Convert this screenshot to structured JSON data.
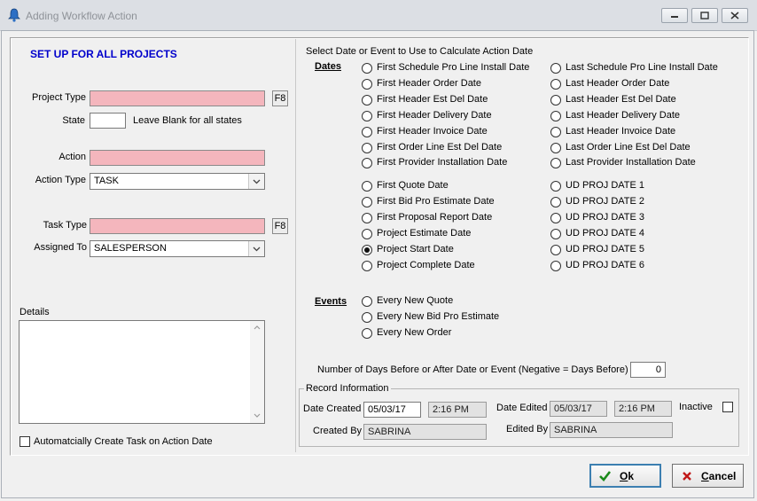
{
  "window": {
    "title": "Adding Workflow Action",
    "icon": "bell-icon"
  },
  "left": {
    "heading": "SET UP FOR ALL PROJECTS",
    "project_type_label": "Project Type",
    "f8_label": "F8",
    "state_label": "State",
    "state_value": "",
    "state_hint": "Leave Blank for all states",
    "action_label": "Action",
    "action_type_label": "Action Type",
    "action_type_value": "TASK",
    "task_type_label": "Task Type",
    "assigned_to_label": "Assigned To",
    "assigned_to_value": "SALESPERSON",
    "details_label": "Details",
    "auto_create_label": "Automatcially Create Task on Action Date"
  },
  "right": {
    "heading": "Select Date or Event to Use to Calculate Action Date",
    "dates_label": "Dates",
    "dates_col1": [
      "First Schedule Pro Line Install Date",
      "First Header Order Date",
      "First Header Est Del Date",
      "First Header Delivery Date",
      "First Header Invoice Date",
      "First Order Line Est Del Date",
      "First Provider Installation Date"
    ],
    "dates_col2": [
      "Last Schedule Pro Line Install Date",
      "Last Header Order Date",
      "Last Header Est Del Date",
      "Last Header Delivery Date",
      "Last Header Invoice Date",
      "Last Order Line Est Del Date",
      "Last Provider Installation Date"
    ],
    "project_col1": [
      "First Quote Date",
      "First Bid Pro Estimate Date",
      "First Proposal Report Date",
      "Project Estimate Date",
      "Project Start Date",
      "Project Complete Date"
    ],
    "project_col2": [
      "UD PROJ DATE 1",
      "UD PROJ DATE 2",
      "UD PROJ DATE 3",
      "UD PROJ DATE 4",
      "UD PROJ DATE 5",
      "UD PROJ DATE 6"
    ],
    "selected": "Project Start Date",
    "events_label": "Events",
    "events": [
      "Every New Quote",
      "Every New Bid Pro Estimate",
      "Every New Order"
    ],
    "days_label": "Number of Days Before or After Date or Event  (Negative = Days Before)",
    "days_value": "0"
  },
  "record": {
    "title": "Record Information",
    "date_created_label": "Date Created",
    "date_created": "05/03/17",
    "time_created": "2:16 PM",
    "date_edited_label": "Date Edited",
    "date_edited": "05/03/17",
    "time_edited": "2:16 PM",
    "inactive_label": "Inactive",
    "created_by_label": "Created By",
    "created_by": "SABRINA",
    "edited_by_label": "Edited By",
    "edited_by": "SABRINA"
  },
  "buttons": {
    "ok": "Ok",
    "cancel": "Cancel"
  },
  "colors": {
    "required_field": "#f4b6bd",
    "heading_blue": "#0000cc",
    "ok_check": "#1a8a1a",
    "cancel_x": "#c01818"
  }
}
